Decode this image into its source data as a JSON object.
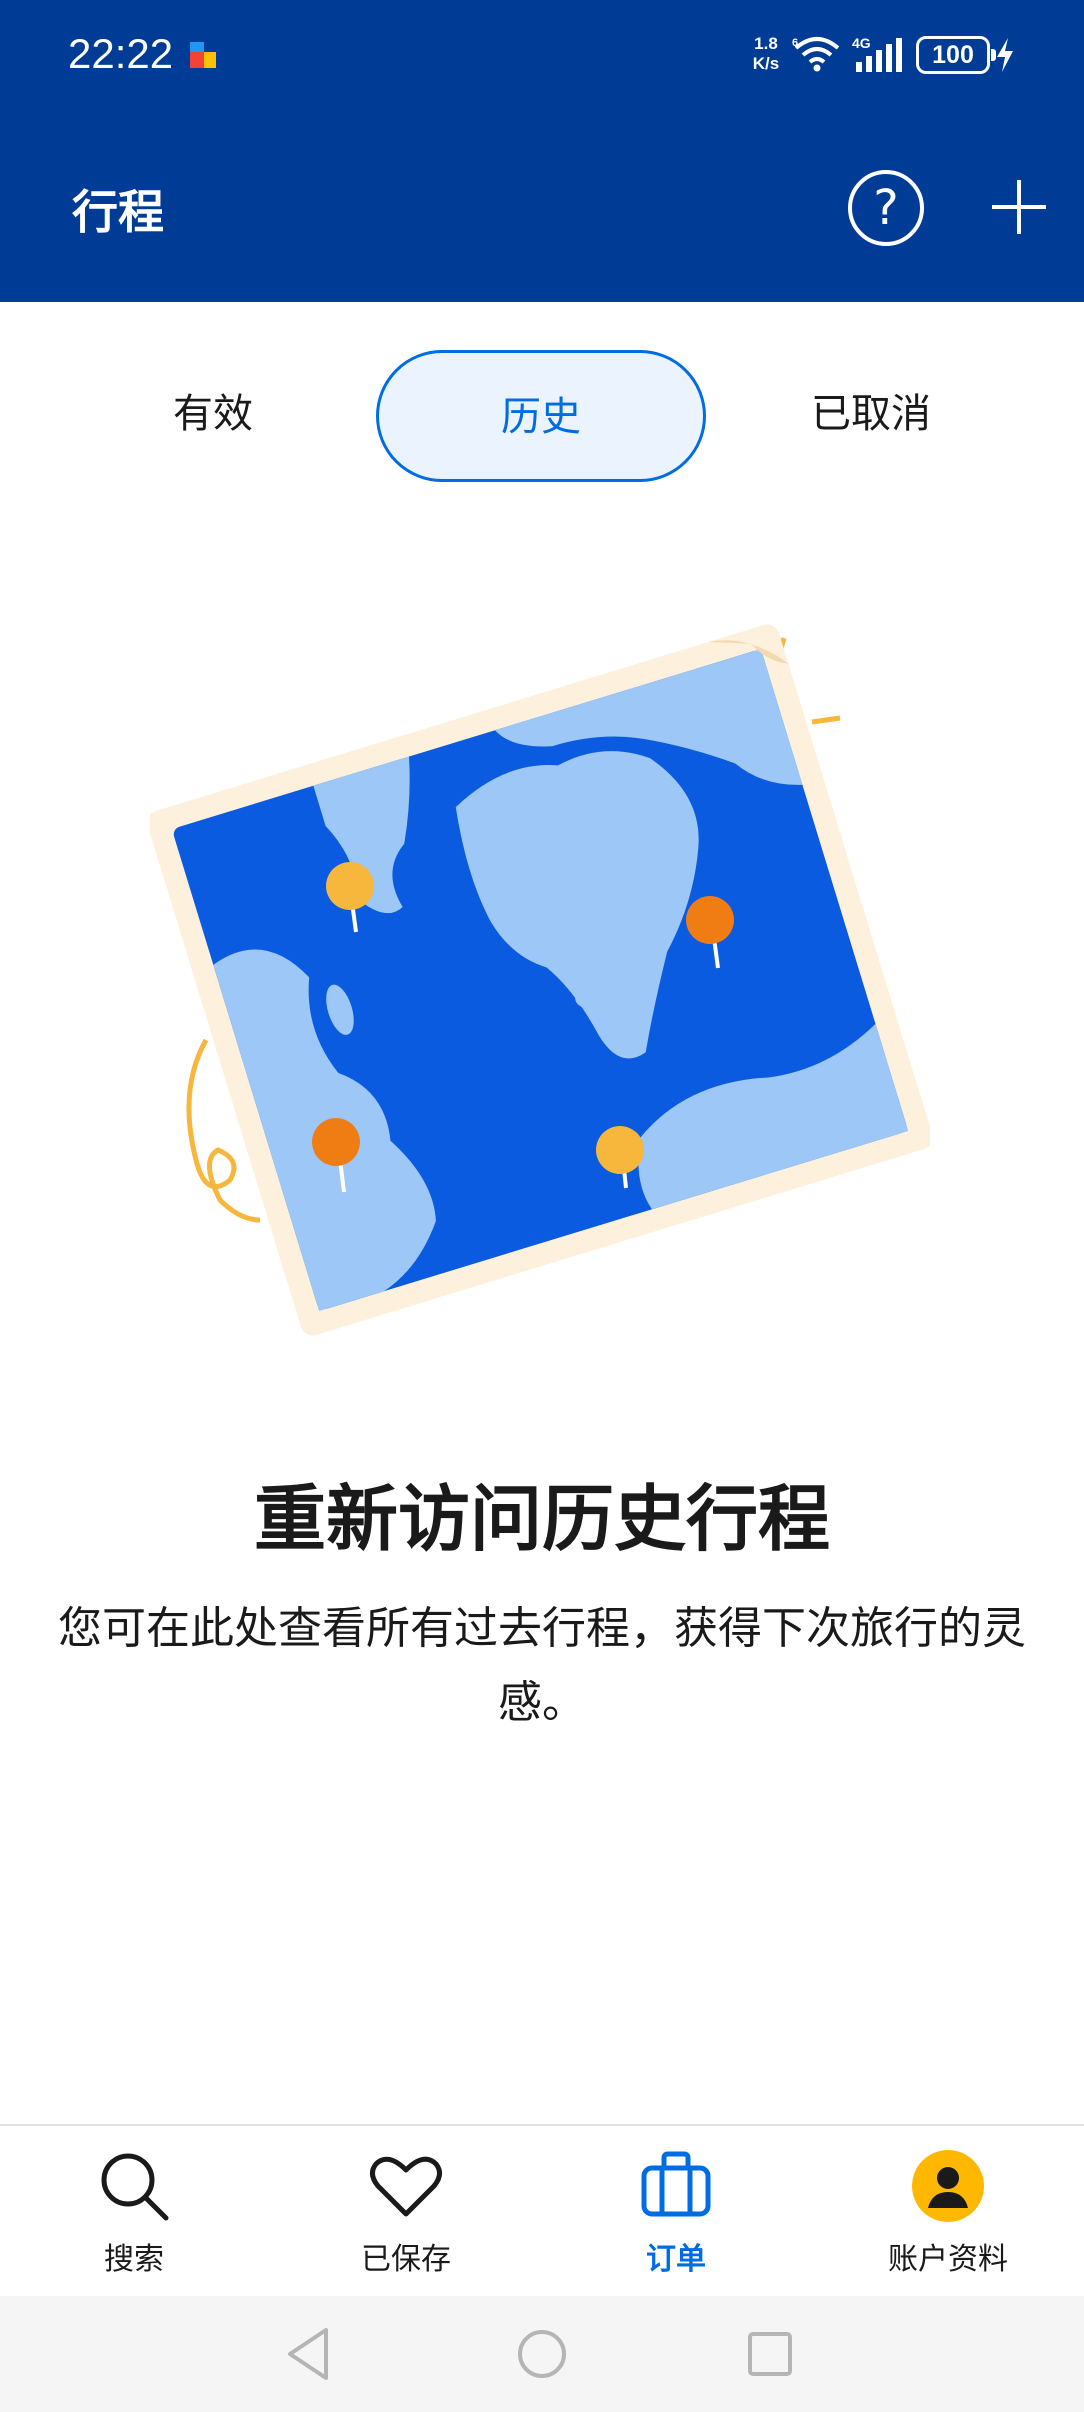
{
  "status_bar": {
    "time": "22:22",
    "net_speed_value": "1.8",
    "net_speed_unit": "K/s",
    "network_type": "4G",
    "battery": "100"
  },
  "header": {
    "title": "行程"
  },
  "tabs": [
    {
      "label": "有效"
    },
    {
      "label": "历史"
    },
    {
      "label": "已取消"
    }
  ],
  "empty_state": {
    "title": "重新访问历史行程",
    "description": "您可在此处查看所有过去行程，获得下次旅行的灵感。"
  },
  "bottom_nav": [
    {
      "label": "搜索"
    },
    {
      "label": "已保存"
    },
    {
      "label": "订单"
    },
    {
      "label": "账户资料"
    }
  ],
  "colors": {
    "header_bg": "#003b95",
    "accent": "#006ce4",
    "tab_active_bg": "#ebf3ff",
    "avatar_bg": "#ffb700"
  }
}
